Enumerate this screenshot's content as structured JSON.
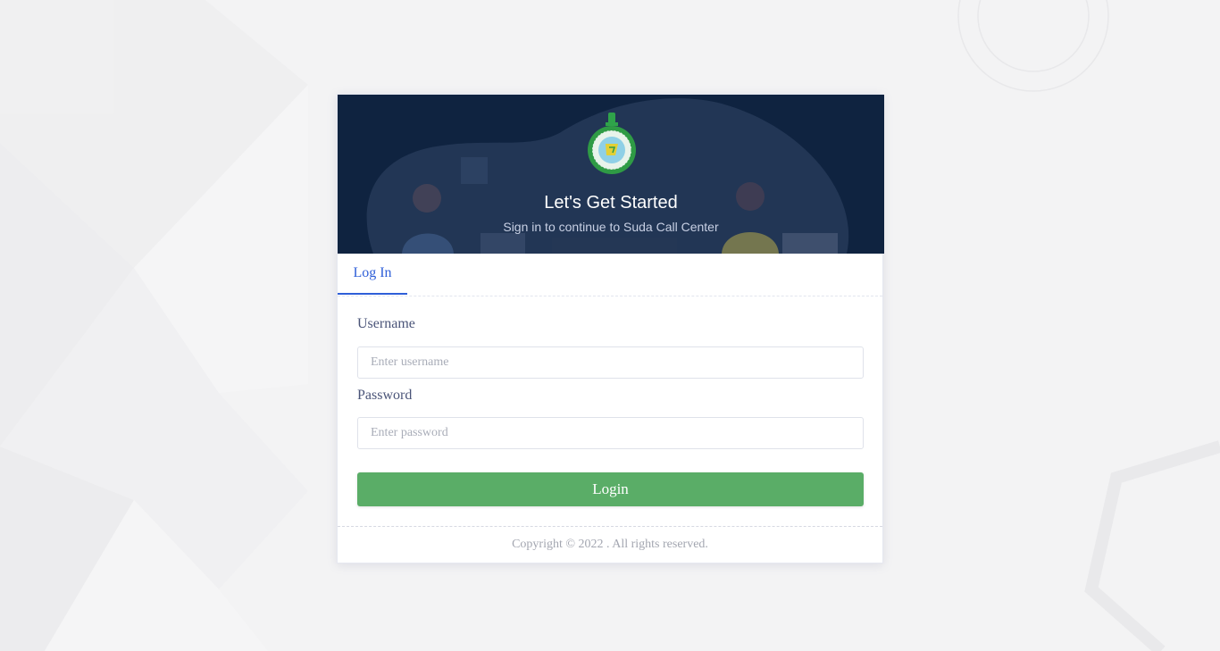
{
  "header": {
    "title": "Let's Get Started",
    "subtitle": "Sign in to continue to Suda Call Center"
  },
  "tabs": [
    {
      "label": "Log In",
      "active": true
    }
  ],
  "form": {
    "username_label": "Username",
    "username_placeholder": "Enter username",
    "username_value": "",
    "password_label": "Password",
    "password_placeholder": "Enter password",
    "password_value": "",
    "submit_label": "Login"
  },
  "footer": {
    "copyright": "Copyright © 2022 . All rights reserved."
  },
  "icons": {
    "emblem": "government-emblem-icon"
  },
  "colors": {
    "hero_bg": "#0f2340",
    "accent": "#2f5fd8",
    "login_button": "#5aad67",
    "page_bg": "#f3f3f4"
  }
}
